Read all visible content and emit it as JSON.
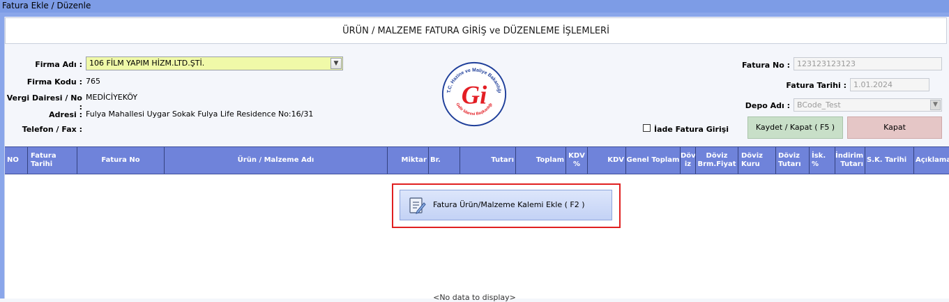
{
  "window": {
    "title": "Fatura Ekle / Düzenle"
  },
  "header": {
    "title": "ÜRÜN / MALZEME FATURA GİRİŞ ve DÜZENLEME İŞLEMLERİ"
  },
  "company": {
    "name_label": "Firma Adı :",
    "name_value": "106 FİLM YAPIM HİZM.LTD.ŞTİ.",
    "code_label": "Firma Kodu :",
    "code_value": "765",
    "tax_label": "Vergi Dairesi / No :",
    "tax_value": "MEDİCİYEKÖY",
    "address_label": "Adresi :",
    "address_value": "Fulya Mahallesi Uygar Sokak Fulya Life Residence No:16/31",
    "phone_label": "Telefon / Fax :"
  },
  "logo": {
    "arc_text": "T.C. Hazine ve Maliye Bakanlığı",
    "bottom_text": "Gelir İdaresi Başkanlığı",
    "glyph": "Gi",
    "color": "#e31e24"
  },
  "invoice": {
    "no_label": "Fatura No :",
    "no_value": "123123123123",
    "date_label": "Fatura Tarihi :",
    "date_value": "1.01.2024",
    "depot_label": "Depo Adı :",
    "depot_value": "BCode_Test"
  },
  "return_checkbox": {
    "label": "İade Fatura Girişi",
    "checked": false
  },
  "buttons": {
    "save_label": "Kaydet / Kapat ( F5 )",
    "close_label": "Kapat"
  },
  "table": {
    "columns": [
      "NO",
      "Fatura Tarihi",
      "Fatura No",
      "Ürün / Malzeme Adı",
      "Miktar",
      "Br.",
      "Tutarı",
      "Toplam",
      "KDV %",
      "KDV",
      "Genel Toplam",
      "Döv iz",
      "Döviz Brm.Fiyat",
      "Döviz Kuru",
      "Döviz Tutarı",
      "İsk. %",
      "İndirim Tutarı",
      "S.K. Tarihi",
      "Açıklama"
    ],
    "add_item_label": "Fatura Ürün/Malzeme Kalemi Ekle ( F2 )",
    "empty_text": "<No data to display>"
  },
  "colors": {
    "title_bar": "#7d9ce6",
    "grid_header": "#6f83da",
    "firm_combo": "#f0f9a8",
    "save_button": "#c8dfc8",
    "close_button": "#e5c6c6",
    "highlight": "#e02020"
  }
}
